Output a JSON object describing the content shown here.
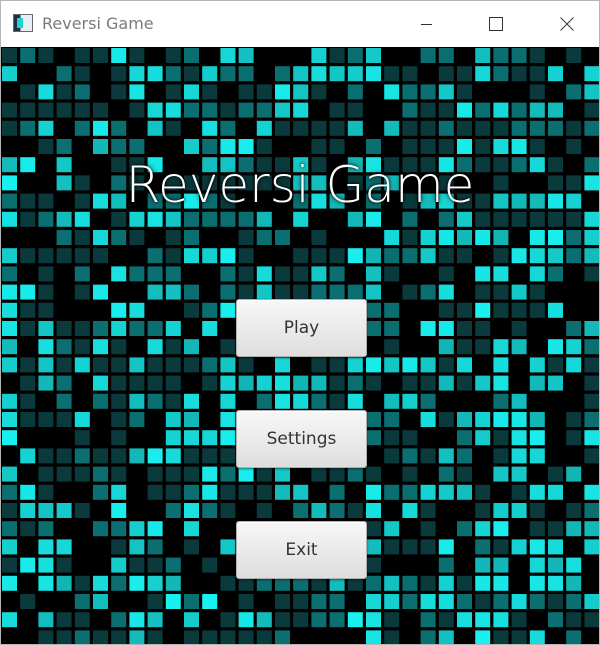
{
  "window": {
    "title": "Reversi Game",
    "icon": "app-icon"
  },
  "controls": {
    "minimize_icon": "minimize-icon",
    "maximize_icon": "maximize-icon",
    "close_icon": "close-icon"
  },
  "main": {
    "heading": "Reversi Game",
    "buttons": [
      {
        "label": "Play"
      },
      {
        "label": "Settings"
      },
      {
        "label": "Exit"
      }
    ]
  },
  "colors": {
    "tile_bright": "#19f0f0",
    "tile_dim": "#0a3a3c",
    "tile_mid": "#0b6f72",
    "background": "#000000"
  }
}
